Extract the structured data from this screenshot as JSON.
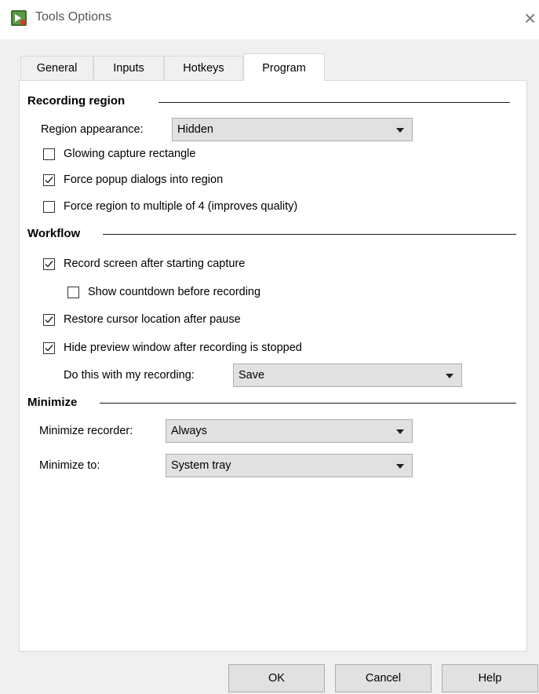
{
  "window": {
    "title": "Tools Options",
    "close_glyph": "×"
  },
  "tabs": [
    {
      "label": "General"
    },
    {
      "label": "Inputs"
    },
    {
      "label": "Hotkeys"
    },
    {
      "label": "Program",
      "selected": true
    }
  ],
  "recording_region": {
    "heading": "Recording region",
    "appearance_label": "Region appearance:",
    "appearance_value": "Hidden",
    "options": [
      {
        "label": "Glowing capture rectangle",
        "checked": false
      },
      {
        "label": "Force popup dialogs into region",
        "checked": true
      },
      {
        "label": "Force region to multiple of 4 (improves quality)",
        "checked": false
      }
    ]
  },
  "workflow": {
    "heading": "Workflow",
    "options": [
      {
        "label": "Record screen after starting capture",
        "checked": true
      },
      {
        "label": "Show countdown before recording",
        "checked": false
      },
      {
        "label": "Restore cursor location after pause",
        "checked": true
      },
      {
        "label": "Hide preview window after recording is stopped",
        "checked": true
      }
    ],
    "recording_action_label": "Do this with my recording:",
    "recording_action_value": "Save"
  },
  "minimize": {
    "heading": "Minimize",
    "recorder_label": "Minimize recorder:",
    "recorder_value": "Always",
    "to_label": "Minimize to:",
    "to_value": "System tray"
  },
  "buttons": {
    "ok": "OK",
    "cancel": "Cancel",
    "help": "Help"
  },
  "colors": {
    "app_icon_bg": "#3c6e2f",
    "app_icon_mark": "#ffffff",
    "app_icon_dot": "#d33b2a"
  }
}
